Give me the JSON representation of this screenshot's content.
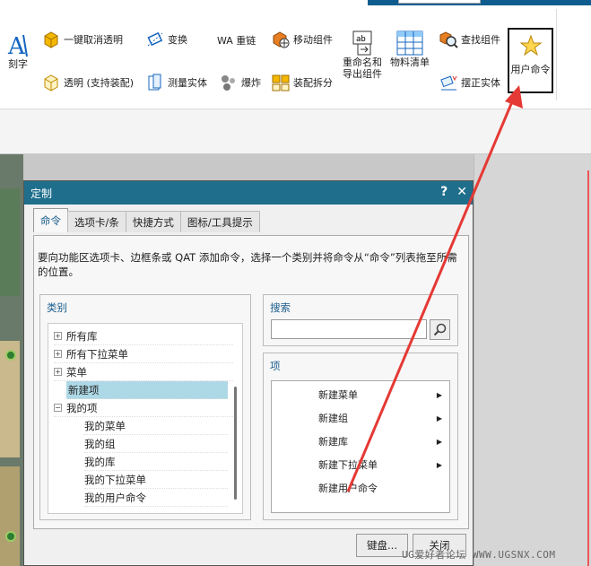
{
  "ribbon": {
    "engrave": "刻字",
    "one_click_untransparent": "一键取消透明",
    "transparent_assembly": "透明 (支持装配)",
    "transform": "变换",
    "measure_body": "测量实体",
    "wa_link": "WA 重链",
    "explode": "爆炸",
    "move_component": "移动组件",
    "assembly_split": "装配拆分",
    "rename_export": "重命名和导出组件",
    "bom": "物料清单",
    "find_component": "查找组件",
    "align_body": "摆正实体",
    "user_command": "用户命令"
  },
  "dialog": {
    "title": "定制",
    "help_icon": "?",
    "close_icon": "✕",
    "tabs": [
      "命令",
      "选项卡/条",
      "快捷方式",
      "图标/工具提示"
    ],
    "description": "要向功能区选项卡、边框条或 QAT 添加命令，选择一个类别并将命令从“命令”列表拖至所需的位置。",
    "category": {
      "title": "类别",
      "items": [
        {
          "label": "所有库",
          "expander": "+",
          "level": 0
        },
        {
          "label": "所有下拉菜单",
          "expander": "+",
          "level": 0
        },
        {
          "label": "菜单",
          "expander": "+",
          "level": 0
        },
        {
          "label": "新建项",
          "expander": "",
          "level": 0,
          "selected": true
        },
        {
          "label": "我的项",
          "expander": "−",
          "level": 0
        },
        {
          "label": "我的菜单",
          "expander": "",
          "level": 1
        },
        {
          "label": "我的组",
          "expander": "",
          "level": 1
        },
        {
          "label": "我的库",
          "expander": "",
          "level": 1
        },
        {
          "label": "我的下拉菜单",
          "expander": "",
          "level": 1
        },
        {
          "label": "我的用户命令",
          "expander": "",
          "level": 1
        }
      ]
    },
    "search": {
      "title": "搜索",
      "value": ""
    },
    "items_group": {
      "title": "项",
      "items": [
        {
          "label": "新建菜单",
          "arrow": "▶"
        },
        {
          "label": "新建组",
          "arrow": "▶"
        },
        {
          "label": "新建库",
          "arrow": "▶"
        },
        {
          "label": "新建下拉菜单",
          "arrow": "▶"
        },
        {
          "label": "新建用户命令",
          "arrow": ""
        }
      ]
    },
    "keyboard_button": "键盘...",
    "close_button": "关闭"
  },
  "watermark": "UG爱好者论坛 WWW.UGSNX.COM",
  "colors": {
    "title_bar": "#1f6e8c",
    "accent_text": "#1a5c8c",
    "selection": "#add8e6",
    "annotation_arrow": "#e53935"
  }
}
